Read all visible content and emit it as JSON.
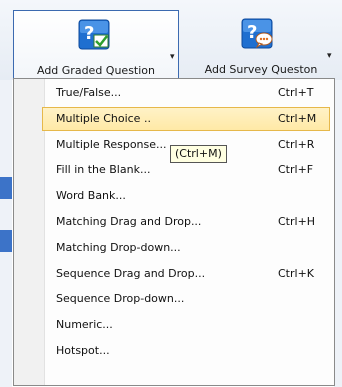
{
  "ribbon": {
    "graded_label": "Add Graded Question",
    "survey_label": "Add Survey Queston",
    "graded_icon": "question-check-icon",
    "survey_icon": "question-chat-icon",
    "arrow": "▾"
  },
  "menu": {
    "items": [
      {
        "label": "True/False...",
        "shortcut": "Ctrl+T"
      },
      {
        "label": "Multiple Choice ..",
        "shortcut": "Ctrl+M",
        "selected": true
      },
      {
        "label": "Multiple Response...",
        "shortcut": "Ctrl+R"
      },
      {
        "label": "Fill in the Blank...",
        "shortcut": "Ctrl+F"
      },
      {
        "label": "Word Bank...",
        "shortcut": ""
      },
      {
        "label": "Matching Drag and Drop...",
        "shortcut": "Ctrl+H"
      },
      {
        "label": "Matching Drop-down...",
        "shortcut": ""
      },
      {
        "label": "Sequence Drag and Drop...",
        "shortcut": "Ctrl+K"
      },
      {
        "label": "Sequence Drop-down...",
        "shortcut": ""
      },
      {
        "label": "Numeric...",
        "shortcut": ""
      },
      {
        "label": "Hotspot...",
        "shortcut": ""
      }
    ]
  },
  "tooltip": {
    "text": "(Ctrl+M)"
  },
  "colors": {
    "accent": "#3c6ab0",
    "highlight": "#ffe9a6",
    "icon_bg": "#1f6fd0"
  }
}
